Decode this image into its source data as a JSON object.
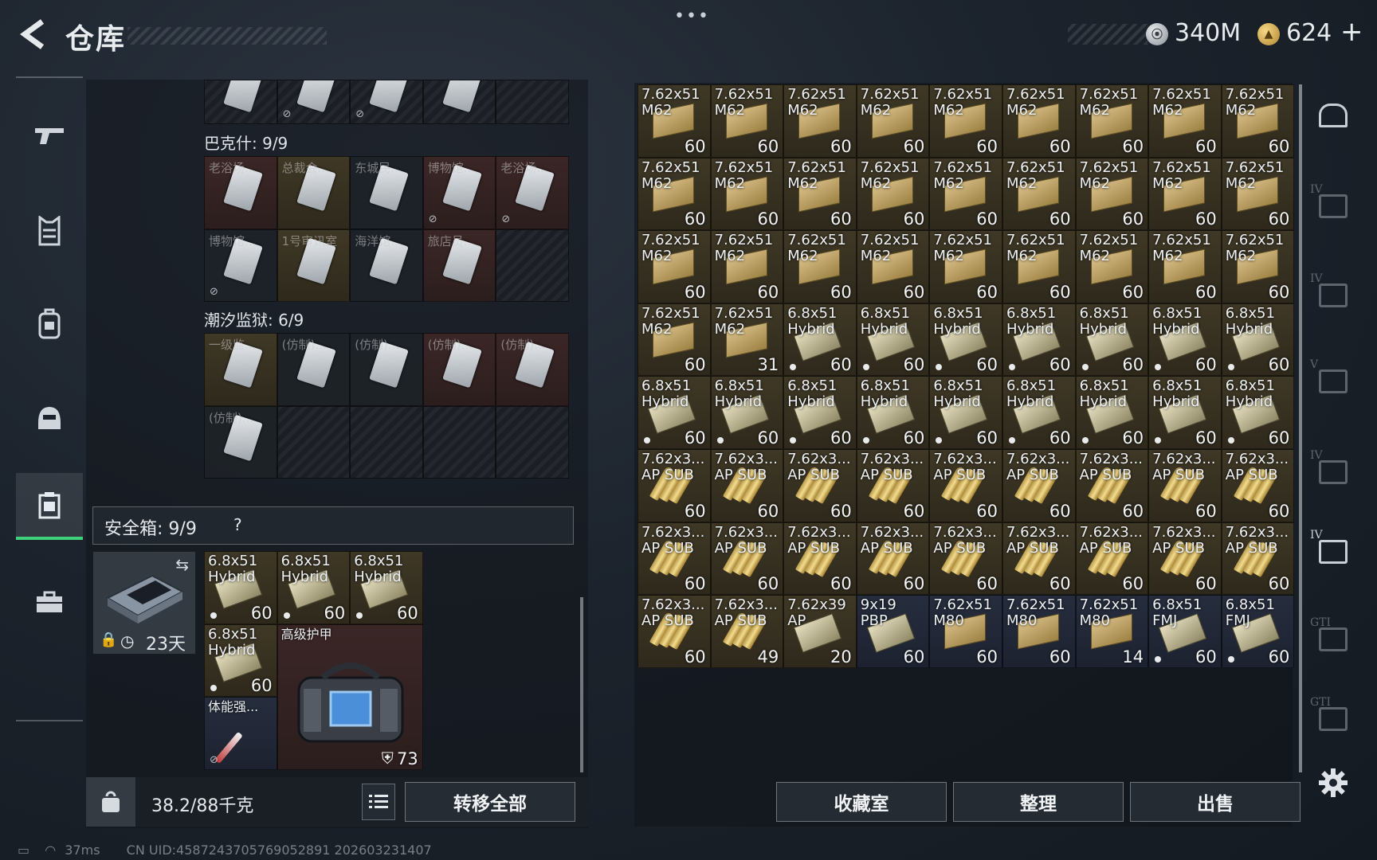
{
  "header": {
    "title": "仓库",
    "more": "•••",
    "currency_silver": "340M",
    "currency_gold": "624",
    "currency_gold_plus": "+"
  },
  "left_nav": {
    "items": [
      "weapon-icon",
      "armor-vest-icon",
      "backpack-icon",
      "helmet-icon",
      "container-icon",
      "briefcase-icon"
    ],
    "active_index": 4
  },
  "left_panel": {
    "section_bakeshi": {
      "title": "巴克什: 9/9",
      "cells": [
        {
          "label": "老浴场...",
          "tone": "red",
          "nolink": false
        },
        {
          "label": "总裁会...",
          "tone": "gold",
          "nolink": false
        },
        {
          "label": "东城民...",
          "tone": "dark",
          "nolink": false
        },
        {
          "label": "博物馆...",
          "tone": "red",
          "nolink": true
        },
        {
          "label": "老浴场...",
          "tone": "red",
          "nolink": true
        },
        {
          "label": "博物馆...",
          "tone": "dark",
          "nolink": true
        },
        {
          "label": "1号审讯室",
          "tone": "gold",
          "nolink": false
        },
        {
          "label": "海洋馆...",
          "tone": "dark",
          "nolink": false
        },
        {
          "label": "旅店员...",
          "tone": "red",
          "nolink": false
        },
        {
          "label": "",
          "tone": "hatch",
          "nolink": false
        }
      ]
    },
    "section_tide": {
      "title": "潮汐监狱: 6/9",
      "cells": [
        {
          "label": "一级监...",
          "tone": "gold"
        },
        {
          "label": "(仿制)...",
          "tone": "dark"
        },
        {
          "label": "(仿制)...",
          "tone": "dark"
        },
        {
          "label": "(仿制)...",
          "tone": "red"
        },
        {
          "label": "(仿制)...",
          "tone": "red"
        },
        {
          "label": "(仿制)...",
          "tone": "dark"
        }
      ]
    },
    "safe": {
      "title": "安全箱: 9/9",
      "help": "?",
      "days": "23天",
      "items": [
        {
          "name1": "6.8x51",
          "name2": "Hybrid",
          "count": "60"
        },
        {
          "name1": "6.8x51",
          "name2": "Hybrid",
          "count": "60"
        },
        {
          "name1": "6.8x51",
          "name2": "Hybrid",
          "count": "60"
        },
        {
          "name1": "6.8x51",
          "name2": "Hybrid",
          "count": "60"
        }
      ],
      "armor_label": "高级护甲",
      "armor_value": "73",
      "stim_label": "体能强..."
    },
    "weight": "38.2/88千克",
    "transfer_all": "转移全部"
  },
  "right_grid": {
    "rows": [
      [
        [
          "7.62x51",
          "M62",
          "60",
          "box"
        ],
        [
          "7.62x51",
          "M62",
          "60",
          "box"
        ],
        [
          "7.62x51",
          "M62",
          "60",
          "box"
        ],
        [
          "7.62x51",
          "M62",
          "60",
          "box"
        ],
        [
          "7.62x51",
          "M62",
          "60",
          "box"
        ],
        [
          "7.62x51",
          "M62",
          "60",
          "box"
        ],
        [
          "7.62x51",
          "M62",
          "60",
          "box"
        ],
        [
          "7.62x51",
          "M62",
          "60",
          "box"
        ],
        [
          "7.62x51",
          "M62",
          "60",
          "box"
        ]
      ],
      [
        [
          "7.62x51",
          "M62",
          "60",
          "box"
        ],
        [
          "7.62x51",
          "M62",
          "60",
          "box"
        ],
        [
          "7.62x51",
          "M62",
          "60",
          "box"
        ],
        [
          "7.62x51",
          "M62",
          "60",
          "box"
        ],
        [
          "7.62x51",
          "M62",
          "60",
          "box"
        ],
        [
          "7.62x51",
          "M62",
          "60",
          "box"
        ],
        [
          "7.62x51",
          "M62",
          "60",
          "box"
        ],
        [
          "7.62x51",
          "M62",
          "60",
          "box"
        ],
        [
          "7.62x51",
          "M62",
          "60",
          "box"
        ]
      ],
      [
        [
          "7.62x51",
          "M62",
          "60",
          "box"
        ],
        [
          "7.62x51",
          "M62",
          "60",
          "box"
        ],
        [
          "7.62x51",
          "M62",
          "60",
          "box"
        ],
        [
          "7.62x51",
          "M62",
          "60",
          "box"
        ],
        [
          "7.62x51",
          "M62",
          "60",
          "box"
        ],
        [
          "7.62x51",
          "M62",
          "60",
          "box"
        ],
        [
          "7.62x51",
          "M62",
          "60",
          "box"
        ],
        [
          "7.62x51",
          "M62",
          "60",
          "box"
        ],
        [
          "7.62x51",
          "M62",
          "60",
          "box"
        ]
      ],
      [
        [
          "7.62x51",
          "M62",
          "60",
          "box"
        ],
        [
          "7.62x51",
          "M62",
          "31",
          "box"
        ],
        [
          "6.8x51",
          "Hybrid",
          "60",
          "hybrid"
        ],
        [
          "6.8x51",
          "Hybrid",
          "60",
          "hybrid"
        ],
        [
          "6.8x51",
          "Hybrid",
          "60",
          "hybrid"
        ],
        [
          "6.8x51",
          "Hybrid",
          "60",
          "hybrid"
        ],
        [
          "6.8x51",
          "Hybrid",
          "60",
          "hybrid"
        ],
        [
          "6.8x51",
          "Hybrid",
          "60",
          "hybrid"
        ],
        [
          "6.8x51",
          "Hybrid",
          "60",
          "hybrid"
        ]
      ],
      [
        [
          "6.8x51",
          "Hybrid",
          "60",
          "hybrid"
        ],
        [
          "6.8x51",
          "Hybrid",
          "60",
          "hybrid"
        ],
        [
          "6.8x51",
          "Hybrid",
          "60",
          "hybrid"
        ],
        [
          "6.8x51",
          "Hybrid",
          "60",
          "hybrid"
        ],
        [
          "6.8x51",
          "Hybrid",
          "60",
          "hybrid"
        ],
        [
          "6.8x51",
          "Hybrid",
          "60",
          "hybrid"
        ],
        [
          "6.8x51",
          "Hybrid",
          "60",
          "hybrid"
        ],
        [
          "6.8x51",
          "Hybrid",
          "60",
          "hybrid"
        ],
        [
          "6.8x51",
          "Hybrid",
          "60",
          "hybrid"
        ]
      ],
      [
        [
          "7.62x3...",
          "AP SUB",
          "60",
          "bullets"
        ],
        [
          "7.62x3...",
          "AP SUB",
          "60",
          "bullets"
        ],
        [
          "7.62x3...",
          "AP SUB",
          "60",
          "bullets"
        ],
        [
          "7.62x3...",
          "AP SUB",
          "60",
          "bullets"
        ],
        [
          "7.62x3...",
          "AP SUB",
          "60",
          "bullets"
        ],
        [
          "7.62x3...",
          "AP SUB",
          "60",
          "bullets"
        ],
        [
          "7.62x3...",
          "AP SUB",
          "60",
          "bullets"
        ],
        [
          "7.62x3...",
          "AP SUB",
          "60",
          "bullets"
        ],
        [
          "7.62x3...",
          "AP SUB",
          "60",
          "bullets"
        ]
      ],
      [
        [
          "7.62x3...",
          "AP SUB",
          "60",
          "bullets"
        ],
        [
          "7.62x3...",
          "AP SUB",
          "60",
          "bullets"
        ],
        [
          "7.62x3...",
          "AP SUB",
          "60",
          "bullets"
        ],
        [
          "7.62x3...",
          "AP SUB",
          "60",
          "bullets"
        ],
        [
          "7.62x3...",
          "AP SUB",
          "60",
          "bullets"
        ],
        [
          "7.62x3...",
          "AP SUB",
          "60",
          "bullets"
        ],
        [
          "7.62x3...",
          "AP SUB",
          "60",
          "bullets"
        ],
        [
          "7.62x3...",
          "AP SUB",
          "60",
          "bullets"
        ],
        [
          "7.62x3...",
          "AP SUB",
          "60",
          "bullets"
        ]
      ],
      [
        [
          "7.62x3...",
          "AP SUB",
          "60",
          "bullets"
        ],
        [
          "7.62x3...",
          "AP SUB",
          "49",
          "bullets"
        ],
        [
          "7.62x39",
          "AP",
          "20",
          "green"
        ],
        [
          "9x19",
          "PBP",
          "60",
          "green-blue"
        ],
        [
          "7.62x51",
          "M80",
          "60",
          "box-blue"
        ],
        [
          "7.62x51",
          "M80",
          "60",
          "box-blue"
        ],
        [
          "7.62x51",
          "M80",
          "14",
          "box-blue"
        ],
        [
          "6.8x51",
          "FMJ",
          "60",
          "hybrid-blue"
        ],
        [
          "6.8x51",
          "FMJ",
          "60",
          "hybrid-blue"
        ]
      ]
    ]
  },
  "bottom_buttons": {
    "collection": "收藏室",
    "sort": "整理",
    "sell": "出售"
  },
  "right_nav": {
    "items": [
      {
        "icon": "shelter-icon",
        "tag": ""
      },
      {
        "icon": "ammo-crate-icon",
        "tag": "IV"
      },
      {
        "icon": "medkit-icon",
        "tag": "IV"
      },
      {
        "icon": "camera-box-icon",
        "tag": "V"
      },
      {
        "icon": "folder-icon",
        "tag": "IV"
      },
      {
        "icon": "folder-icon-active",
        "tag": "IV"
      },
      {
        "icon": "gti-icon",
        "tag": "GTI"
      },
      {
        "icon": "gti-icon-2",
        "tag": "GTI"
      }
    ]
  },
  "status_bar": {
    "ping": "37ms",
    "uid": "CN UID:4587243705769052891 202603231407"
  }
}
